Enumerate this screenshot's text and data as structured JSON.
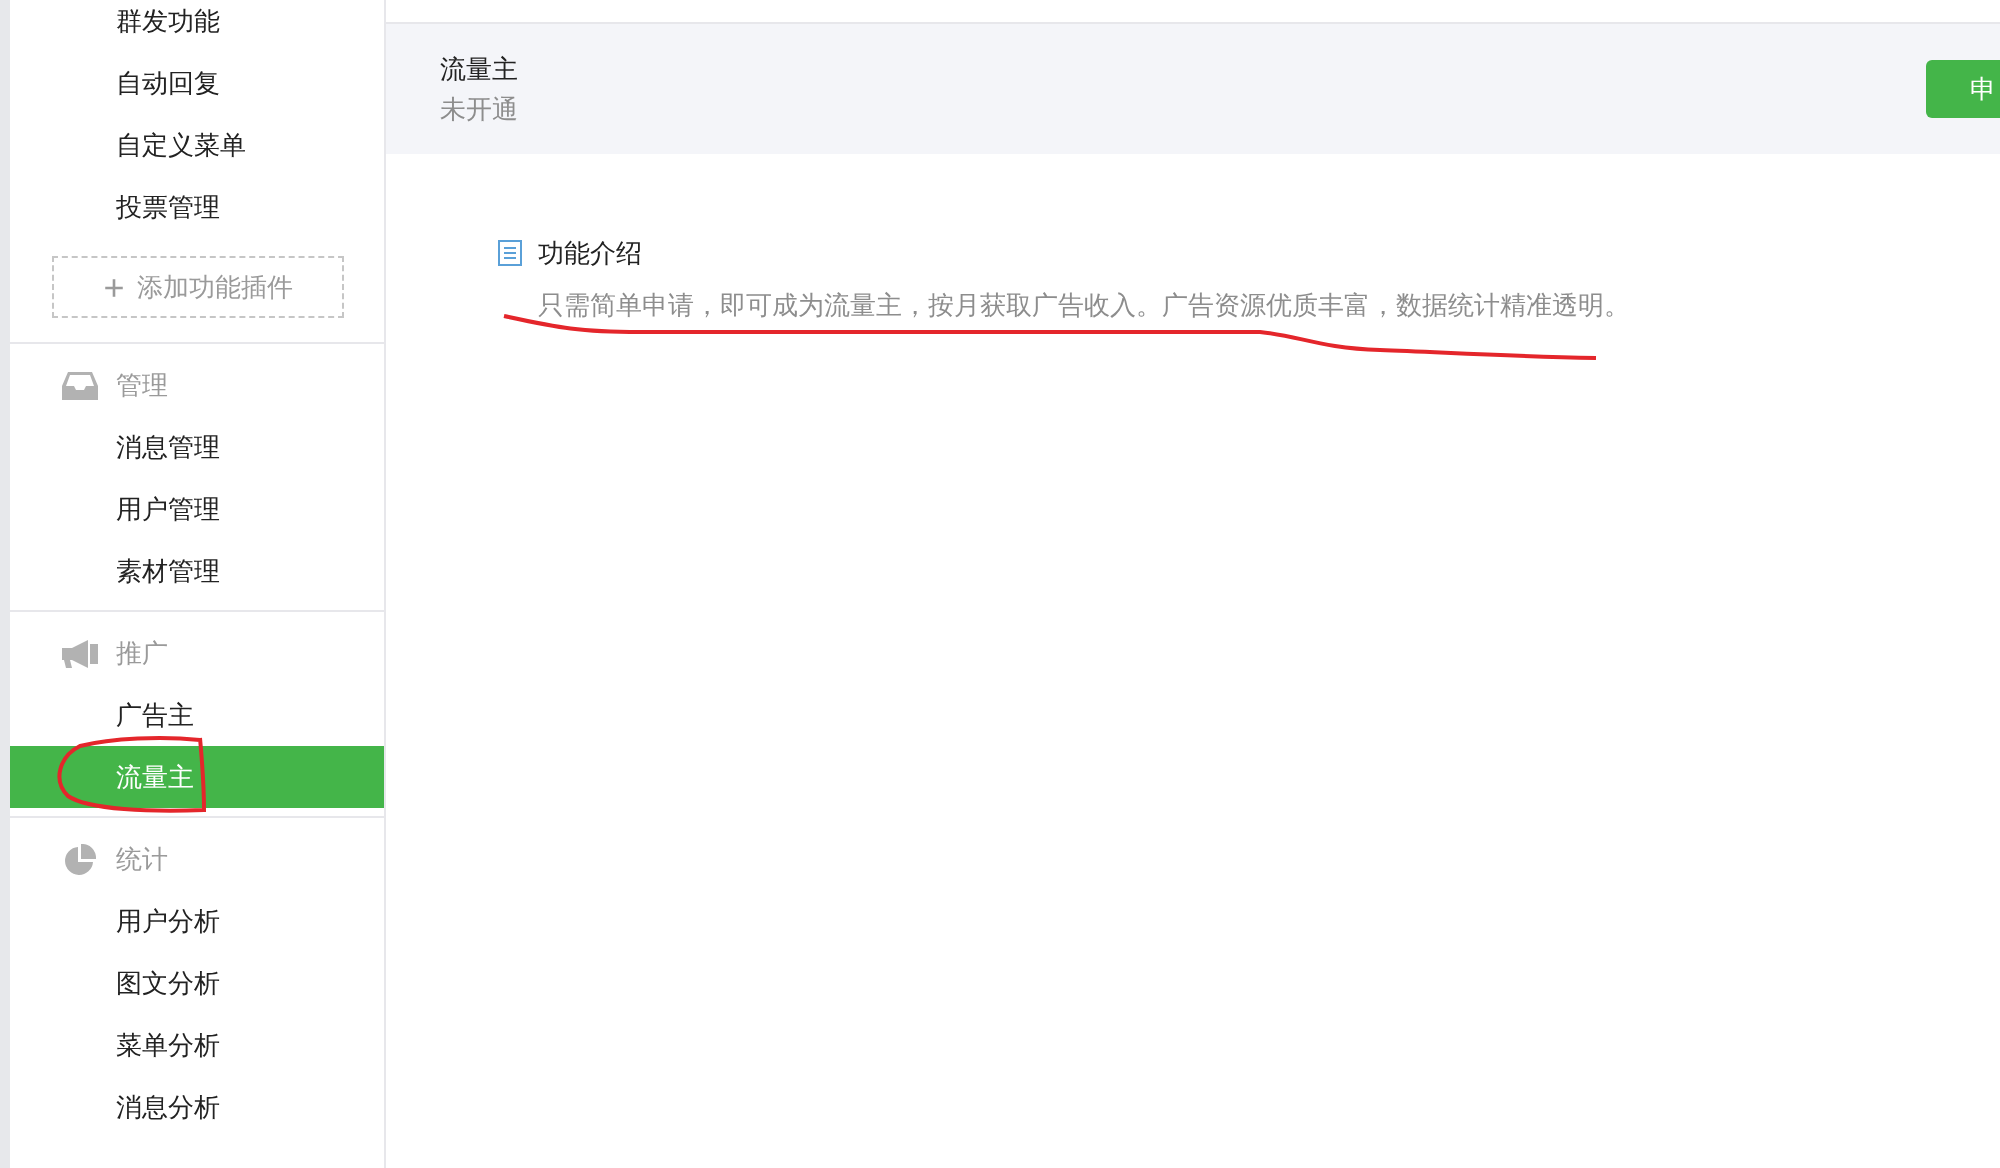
{
  "sidebar": {
    "top_items": [
      {
        "label": "群发功能",
        "selected": false
      },
      {
        "label": "自动回复",
        "selected": false
      },
      {
        "label": "自定义菜单",
        "selected": false
      },
      {
        "label": "投票管理",
        "selected": false
      }
    ],
    "add_plugin": {
      "icon": "+",
      "label": "添加功能插件"
    },
    "groups": [
      {
        "kind": "inbox",
        "title": "管理",
        "items": [
          {
            "label": "消息管理",
            "selected": false
          },
          {
            "label": "用户管理",
            "selected": false
          },
          {
            "label": "素材管理",
            "selected": false
          }
        ]
      },
      {
        "kind": "megaphone",
        "title": "推广",
        "items": [
          {
            "label": "广告主",
            "selected": false
          },
          {
            "label": "流量主",
            "selected": true
          }
        ]
      },
      {
        "kind": "pie",
        "title": "统计",
        "items": [
          {
            "label": "用户分析",
            "selected": false
          },
          {
            "label": "图文分析",
            "selected": false
          },
          {
            "label": "菜单分析",
            "selected": false
          },
          {
            "label": "消息分析",
            "selected": false
          }
        ]
      }
    ]
  },
  "header": {
    "title": "流量主",
    "status": "未开通",
    "button": "申"
  },
  "intro": {
    "title": "功能介绍",
    "text": "只需简单申请，即可成为流量主，按月获取广告收入。广告资源优质丰富，数据统计精准透明。"
  }
}
